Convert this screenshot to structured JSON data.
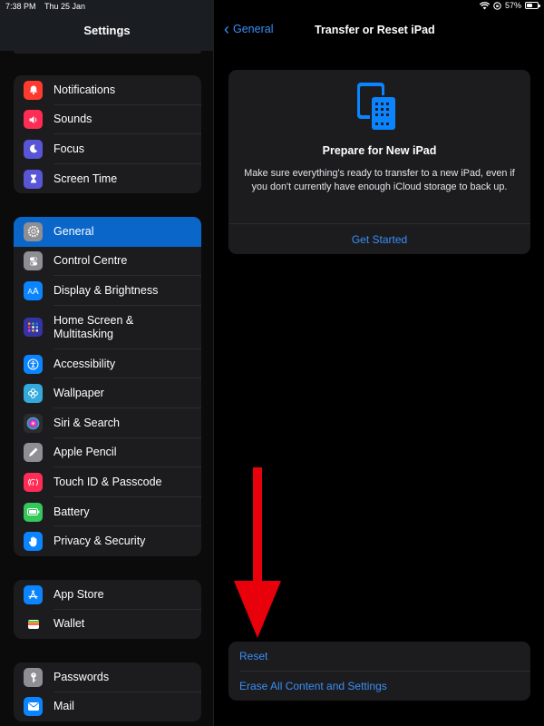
{
  "status": {
    "time": "7:38 PM",
    "date": "Thu 25 Jan",
    "battery": "57%",
    "battery_level": 0.57
  },
  "sidebar": {
    "title": "Settings",
    "groups": [
      [
        {
          "label": "Notifications",
          "icon": "bell-icon",
          "color": "#ff3b30"
        },
        {
          "label": "Sounds",
          "icon": "speaker-icon",
          "color": "#ff2d55"
        },
        {
          "label": "Focus",
          "icon": "moon-icon",
          "color": "#5856d6"
        },
        {
          "label": "Screen Time",
          "icon": "hourglass-icon",
          "color": "#5856d6"
        }
      ],
      [
        {
          "label": "General",
          "icon": "gear-icon",
          "color": "#8e8e93",
          "active": true
        },
        {
          "label": "Control Centre",
          "icon": "toggles-icon",
          "color": "#8e8e93"
        },
        {
          "label": "Display & Brightness",
          "icon": "text-size-icon",
          "color": "#0a84ff"
        },
        {
          "label": "Home Screen & Multitasking",
          "icon": "grid-icon",
          "color": "#3634a3"
        },
        {
          "label": "Accessibility",
          "icon": "accessibility-icon",
          "color": "#0a84ff"
        },
        {
          "label": "Wallpaper",
          "icon": "flower-icon",
          "color": "#34aadc"
        },
        {
          "label": "Siri & Search",
          "icon": "siri-icon",
          "color": "#2c2c2e"
        },
        {
          "label": "Apple Pencil",
          "icon": "pencil-icon",
          "color": "#8e8e93"
        },
        {
          "label": "Touch ID & Passcode",
          "icon": "fingerprint-icon",
          "color": "#ff2d55"
        },
        {
          "label": "Battery",
          "icon": "battery-icon",
          "color": "#34c759"
        },
        {
          "label": "Privacy & Security",
          "icon": "hand-icon",
          "color": "#0a84ff"
        }
      ],
      [
        {
          "label": "App Store",
          "icon": "app-store-icon",
          "color": "#0a84ff"
        },
        {
          "label": "Wallet",
          "icon": "wallet-icon",
          "color": "#1c1c1e"
        }
      ],
      [
        {
          "label": "Passwords",
          "icon": "key-icon",
          "color": "#8e8e93"
        },
        {
          "label": "Mail",
          "icon": "mail-icon",
          "color": "#0a84ff"
        }
      ]
    ]
  },
  "detail": {
    "back_label": "General",
    "title": "Transfer or Reset iPad",
    "card": {
      "title": "Prepare for New iPad",
      "description": "Make sure everything's ready to transfer to a new iPad, even if you don't currently have enough iCloud storage to back up.",
      "link": "Get Started"
    },
    "actions": {
      "reset": "Reset",
      "erase": "Erase All Content and Settings"
    }
  },
  "colors": {
    "accent": "#3a8ff7",
    "arrow": "#e8000b"
  }
}
